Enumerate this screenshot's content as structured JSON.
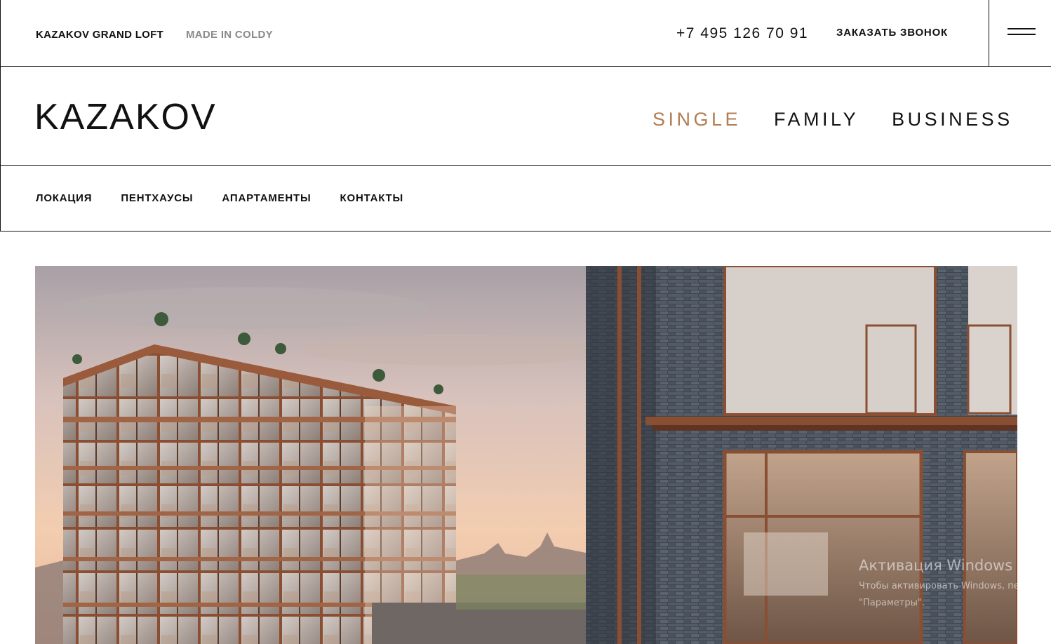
{
  "header": {
    "brand": "KAZAKOV GRAND LOFT",
    "maker": "MADE IN COLDY",
    "phone": "+7 495 126 70 91",
    "callback_label": "ЗАКАЗАТЬ ЗВОНОК",
    "menu_icon": "hamburger-menu-icon"
  },
  "logo": {
    "text": "KAZAKOV"
  },
  "segments": [
    {
      "label": "SINGLE",
      "active": true
    },
    {
      "label": "FAMILY",
      "active": false
    },
    {
      "label": "BUSINESS",
      "active": false
    }
  ],
  "nav": [
    {
      "label": "ЛОКАЦИЯ"
    },
    {
      "label": "ПЕНТХАУСЫ"
    },
    {
      "label": "АПАРТАМЕНТЫ"
    },
    {
      "label": "КОНТАКТЫ"
    }
  ],
  "hero": {
    "image": "building-rendering"
  },
  "watermark": {
    "title": "Активация Windows",
    "line1": "Чтобы активировать Windows, пе",
    "line2": "\"Параметры\"."
  },
  "colors": {
    "accent": "#b27d52",
    "text": "#111111",
    "muted": "#8a8a8a"
  }
}
